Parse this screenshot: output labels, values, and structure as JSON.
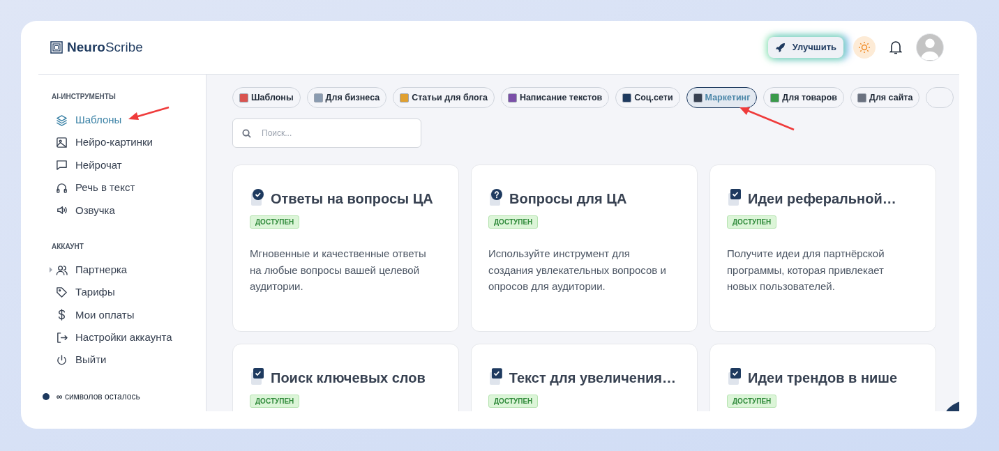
{
  "header": {
    "logo": "**Neuro**Scribe",
    "upgrade_button": "Улучшить"
  },
  "sidebar": {
    "sections": [
      {
        "title": "AI-ИНСТРУМЕНТЫ",
        "items": [
          {
            "label": "Шаблоны",
            "selected": true
          },
          {
            "label": "Нейро-картинки",
            "selected": false
          },
          {
            "label": "Нейрочат",
            "selected": false
          },
          {
            "label": "Речь в текст",
            "selected": false
          },
          {
            "label": "Озвучка",
            "selected": false
          }
        ]
      },
      {
        "title": "АККАУНТ",
        "items": [
          {
            "label": "Партнерка",
            "selected": false,
            "expandable": true
          },
          {
            "label": "Тарифы",
            "selected": false,
            "expandable": false
          },
          {
            "label": "Мои оплаты",
            "selected": false,
            "expandable": false
          },
          {
            "label": "Настройки аккаунта",
            "selected": false,
            "expandable": false
          },
          {
            "label": "Выйти",
            "selected": false,
            "expandable": false
          }
        ]
      }
    ],
    "credits": "**∞** символов осталось"
  },
  "categories": [
    {
      "label": "Шаблоны",
      "color": "#d9534f",
      "selected": false
    },
    {
      "label": "Для бизнеса",
      "color": "#8a9bb0",
      "selected": false
    },
    {
      "label": "Статьи для блога",
      "color": "#e0a030",
      "selected": false
    },
    {
      "label": "Написание текстов",
      "color": "#7b4fa8",
      "selected": false
    },
    {
      "label": "Соц.сети",
      "color": "#1e3a5f",
      "selected": false
    },
    {
      "label": "Маркетинг",
      "color": "#374151",
      "selected": true
    },
    {
      "label": "Для товаров",
      "color": "#3a9a4a",
      "selected": false
    },
    {
      "label": "Для сайта",
      "color": "#6b7280",
      "selected": false
    }
  ],
  "search": {
    "placeholder": "Поиск..."
  },
  "cards": [
    {
      "kind": "check",
      "title": "Ответы на вопросы ЦА",
      "badge": "ДОСТУПЕН",
      "description": "Мгновенные и качественные ответы на любые вопросы вашей целевой аудитории."
    },
    {
      "kind": "question",
      "title": "Вопросы для ЦА",
      "badge": "ДОСТУПЕН",
      "description": "Используйте инструмент для создания увлекательных вопросов и опросов для аудитории."
    },
    {
      "kind": "task",
      "title": "Идеи реферальной…",
      "badge": "ДОСТУПЕН",
      "description": "Получите идеи для партнёрской программы, которая привлекает новых пользователей."
    },
    {
      "kind": "task",
      "title": "Поиск ключевых слов",
      "badge": "ДОСТУПЕН"
    },
    {
      "kind": "task",
      "title": "Текст для увеличения…",
      "badge": "ДОСТУПЕН"
    },
    {
      "kind": "task",
      "title": "Идеи трендов в нише",
      "badge": "ДОСТУПЕН"
    }
  ]
}
